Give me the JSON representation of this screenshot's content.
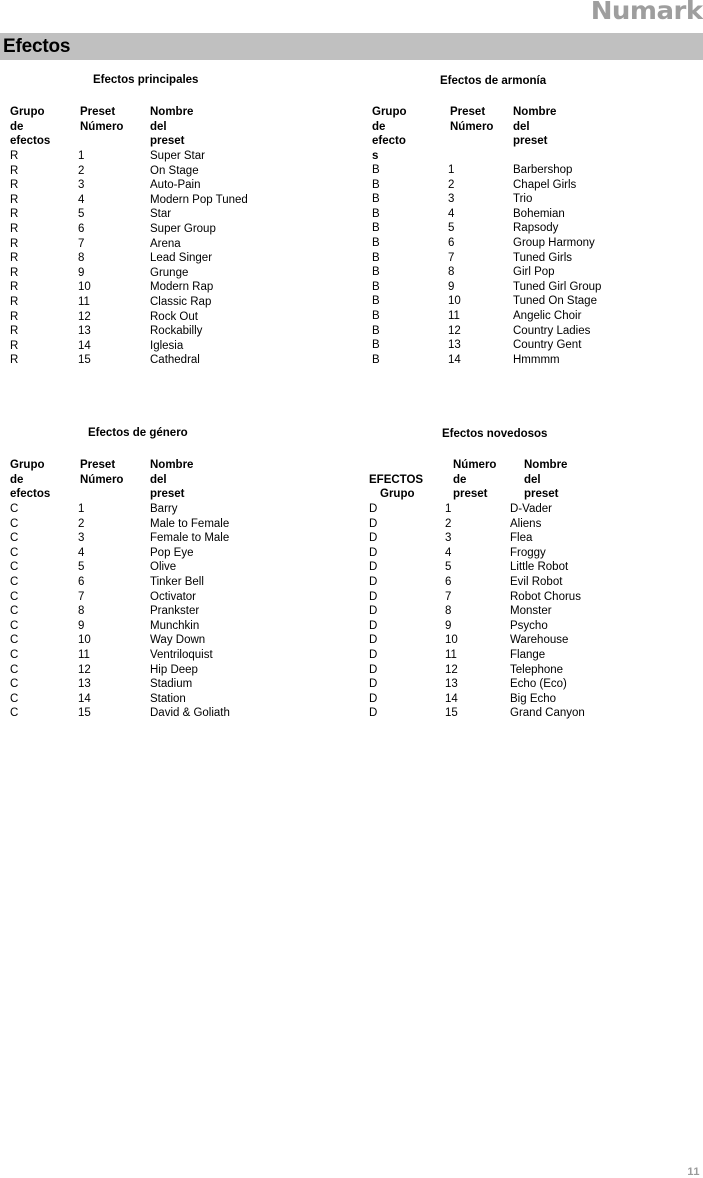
{
  "brand": {
    "name": "Numark"
  },
  "section": {
    "title": "Efectos"
  },
  "page": {
    "number": "11"
  },
  "tables": [
    {
      "id": "efectos-principales",
      "title": "Efectos principales",
      "headers": {
        "group": "Grupo\nde\nefectos",
        "number": "Preset\n Número",
        "name": "Nombre del preset"
      },
      "rows": [
        {
          "group": "R",
          "number": "1",
          "name": "Super Star"
        },
        {
          "group": "R",
          "number": "2",
          "name": "On Stage"
        },
        {
          "group": "R",
          "number": "3",
          "name": "Auto-Pain"
        },
        {
          "group": "R",
          "number": "4",
          "name": "Modern Pop Tuned"
        },
        {
          "group": "R",
          "number": "5",
          "name": "Star"
        },
        {
          "group": "R",
          "number": "6",
          "name": "Super Group"
        },
        {
          "group": "R",
          "number": "7",
          "name": "Arena"
        },
        {
          "group": "R",
          "number": "8",
          "name": "Lead Singer"
        },
        {
          "group": "R",
          "number": "9",
          "name": "Grunge"
        },
        {
          "group": "R",
          "number": "10",
          "name": "Modern Rap"
        },
        {
          "group": "R",
          "number": "11",
          "name": "Classic Rap"
        },
        {
          "group": "R",
          "number": "12",
          "name": "Rock Out"
        },
        {
          "group": "R",
          "number": "13",
          "name": "Rockabilly"
        },
        {
          "group": "R",
          "number": "14",
          "name": "Iglesia"
        },
        {
          "group": "R",
          "number": "15",
          "name": "Cathedral"
        }
      ]
    },
    {
      "id": "efectos-de-armonia",
      "title": "Efectos de armonía",
      "headers": {
        "group": "Grupo\nde\nefecto\ns",
        "number": "Preset\n Número",
        "name": "Nombre del preset"
      },
      "rows": [
        {
          "group": "B",
          "number": "1",
          "name": "Barbershop"
        },
        {
          "group": "B",
          "number": "2",
          "name": "Chapel Girls"
        },
        {
          "group": "B",
          "number": "3",
          "name": "Trio"
        },
        {
          "group": "B",
          "number": "4",
          "name": "Bohemian"
        },
        {
          "group": "B",
          "number": "5",
          "name": "Rapsody"
        },
        {
          "group": "B",
          "number": "6",
          "name": "Group Harmony"
        },
        {
          "group": "B",
          "number": "7",
          "name": "Tuned Girls"
        },
        {
          "group": "B",
          "number": "8",
          "name": "Girl Pop"
        },
        {
          "group": "B",
          "number": "9",
          "name": "Tuned Girl Group"
        },
        {
          "group": "B",
          "number": "10",
          "name": "Tuned On Stage"
        },
        {
          "group": "B",
          "number": "11",
          "name": "Angelic Choir"
        },
        {
          "group": "B",
          "number": "12",
          "name": "Country Ladies"
        },
        {
          "group": "B",
          "number": "13",
          "name": "Country Gent"
        },
        {
          "group": "B",
          "number": "14",
          "name": "Hmmmm"
        }
      ]
    },
    {
      "id": "efectos-de-genero",
      "title": "Efectos de género",
      "headers": {
        "group": "Grupo\nde\nefectos",
        "number": "Preset\nNúmero",
        "name": "Nombre del preset"
      },
      "rows": [
        {
          "group": "C",
          "number": "1",
          "name": "Barry"
        },
        {
          "group": "C",
          "number": "2",
          "name": "Male to Female"
        },
        {
          "group": "C",
          "number": "3",
          "name": "Female to Male"
        },
        {
          "group": "C",
          "number": "4",
          "name": "Pop Eye"
        },
        {
          "group": "C",
          "number": "5",
          "name": "Olive"
        },
        {
          "group": "C",
          "number": "6",
          "name": "Tinker Bell"
        },
        {
          "group": "C",
          "number": "7",
          "name": "Octivator"
        },
        {
          "group": "C",
          "number": "8",
          "name": "Prankster"
        },
        {
          "group": "C",
          "number": "9",
          "name": "Munchkin"
        },
        {
          "group": "C",
          "number": "10",
          "name": "Way Down"
        },
        {
          "group": "C",
          "number": "11",
          "name": "Ventriloquist"
        },
        {
          "group": "C",
          "number": "12",
          "name": "Hip Deep"
        },
        {
          "group": "C",
          "number": "13",
          "name": "Stadium"
        },
        {
          "group": "C",
          "number": "14",
          "name": "Station"
        },
        {
          "group": "C",
          "number": "15",
          "name": "David & Goliath"
        }
      ]
    },
    {
      "id": "efectos-novedosos",
      "title": "Efectos novedosos",
      "headers": {
        "group_line1": "EFECTOS",
        "group_line2": "Grupo",
        "number": "Número\nde\npreset",
        "name": "Nombre del preset"
      },
      "rows": [
        {
          "group": "D",
          "number": "1",
          "name": "D-Vader"
        },
        {
          "group": "D",
          "number": "2",
          "name": "Aliens"
        },
        {
          "group": "D",
          "number": "3",
          "name": "Flea"
        },
        {
          "group": "D",
          "number": "4",
          "name": "Froggy"
        },
        {
          "group": "D",
          "number": "5",
          "name": "Little Robot"
        },
        {
          "group": "D",
          "number": "6",
          "name": "Evil Robot"
        },
        {
          "group": "D",
          "number": "7",
          "name": "Robot Chorus"
        },
        {
          "group": "D",
          "number": "8",
          "name": "Monster"
        },
        {
          "group": "D",
          "number": "9",
          "name": "Psycho"
        },
        {
          "group": "D",
          "number": "10",
          "name": "Warehouse"
        },
        {
          "group": "D",
          "number": "11",
          "name": "Flange"
        },
        {
          "group": "D",
          "number": "12",
          "name": "Telephone"
        },
        {
          "group": "D",
          "number": "13",
          "name": "Echo (Eco)"
        },
        {
          "group": "D",
          "number": "14",
          "name": "Big Echo"
        },
        {
          "group": "D",
          "number": "15",
          "name": "Grand Canyon"
        }
      ]
    }
  ]
}
